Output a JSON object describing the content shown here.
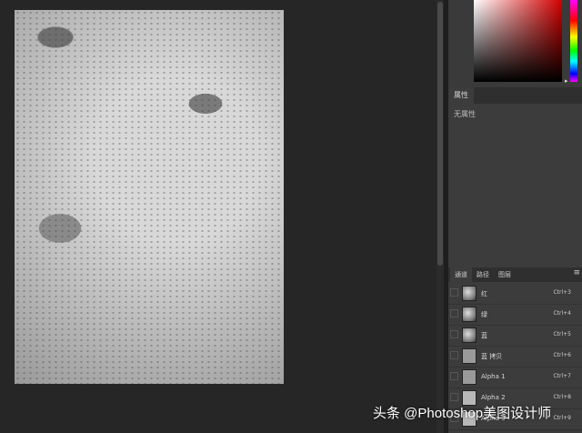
{
  "properties_panel": {
    "tab_label": "属性",
    "empty_text": "无属性"
  },
  "channels_panel": {
    "tabs": [
      "通道",
      "路径",
      "图层"
    ],
    "menu_icon": "panel-menu-icon",
    "channels": [
      {
        "name": "红",
        "shortcut": "Ctrl+3"
      },
      {
        "name": "绿",
        "shortcut": "Ctrl+4"
      },
      {
        "name": "蓝",
        "shortcut": "Ctrl+5"
      },
      {
        "name": "蓝 拷贝",
        "shortcut": "Ctrl+6"
      },
      {
        "name": "Alpha 1",
        "shortcut": "Ctrl+7"
      },
      {
        "name": "Alpha 2",
        "shortcut": "Ctrl+8"
      },
      {
        "name": "Alpha 3",
        "shortcut": "Ctrl+9"
      }
    ]
  },
  "watermark": "头条 @Photoshop美图设计师",
  "colors": {
    "workspace": "#262626",
    "panel": "#3c3c3c",
    "picker_hue": "#d40000"
  }
}
